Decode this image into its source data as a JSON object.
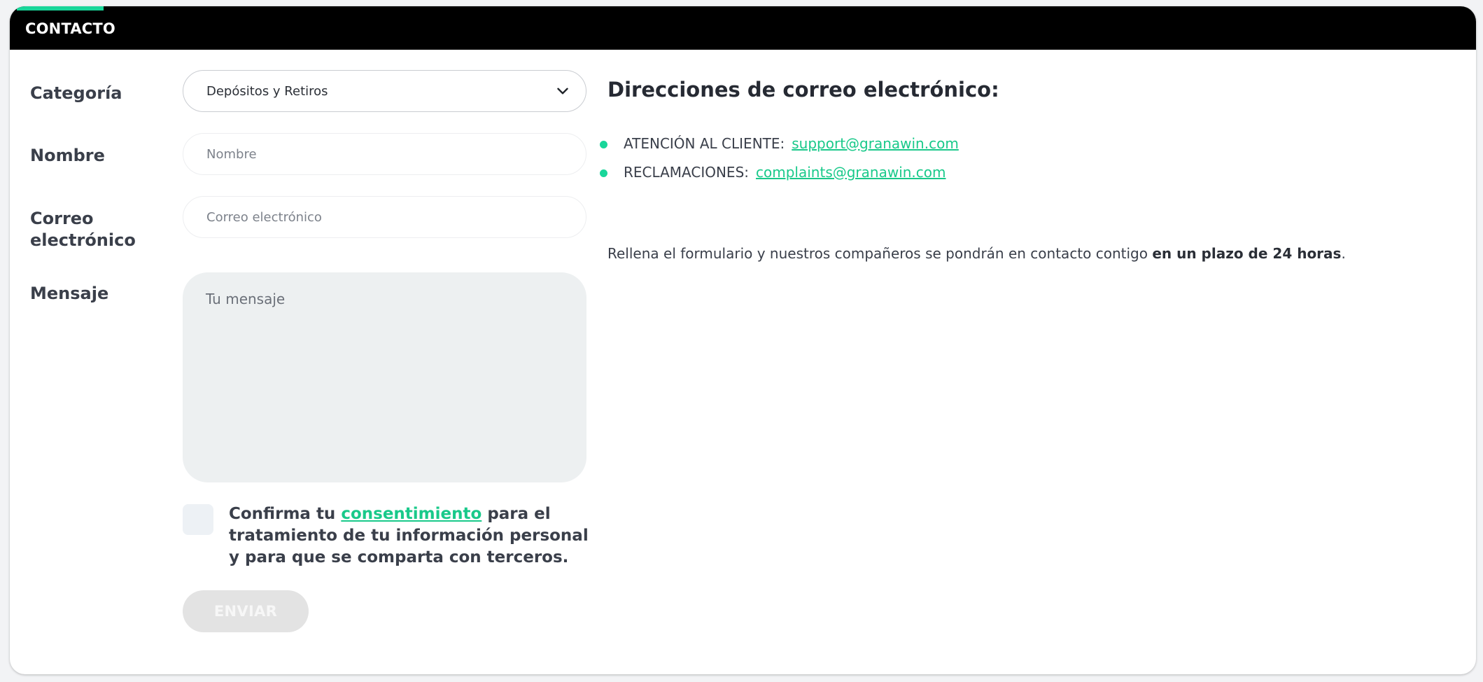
{
  "header": {
    "title": "CONTACTO"
  },
  "form": {
    "category_label": "Categoría",
    "category_value": "Depósitos y Retiros",
    "name_label": "Nombre",
    "name_placeholder": "Nombre",
    "email_label_line1": "Correo",
    "email_label_line2": "electrónico",
    "email_placeholder": "Correo electrónico",
    "message_label": "Mensaje",
    "message_placeholder": "Tu mensaje",
    "consent_prefix": "Confirma tu ",
    "consent_link": "consentimiento",
    "consent_suffix": " para el tratamiento de tu información personal y para que se comparta con terceros.",
    "submit_label": "ENVIAR"
  },
  "emails": {
    "title": "Direcciones de correo electrónico:",
    "items": [
      {
        "label": "ATENCIÓN AL CLIENTE:",
        "address": "support@granawin.com"
      },
      {
        "label": "RECLAMACIONES:",
        "address": "complaints@granawin.com"
      }
    ],
    "info_text": "Rellena el formulario y nuestros compañeros se pondrán en contacto contigo ",
    "info_bold": "en un plazo de 24 horas",
    "info_end": "."
  },
  "colors": {
    "accent": "#19d69a",
    "header_bg": "#000000",
    "link": "#19c98a"
  },
  "icons": {
    "select_chevron": "chevron-down-icon"
  }
}
